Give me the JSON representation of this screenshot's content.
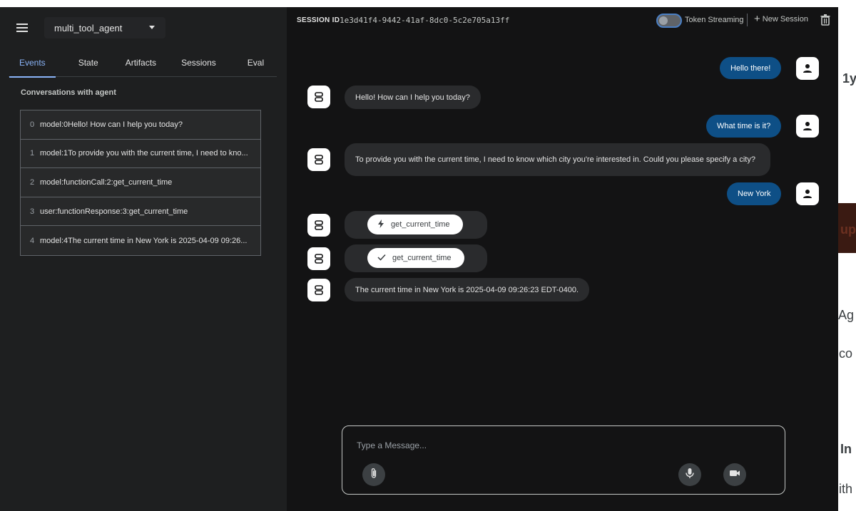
{
  "header": {
    "agent_name": "multi_tool_agent",
    "session_label": "SESSION ID",
    "session_id": "1e3d41f4-9442-41af-8dc0-5c2e705a13ff",
    "token_streaming_label": "Token Streaming",
    "token_streaming_enabled": false,
    "new_session_label": "New Session"
  },
  "tabs": [
    {
      "label": "Events",
      "active": true
    },
    {
      "label": "State",
      "active": false
    },
    {
      "label": "Artifacts",
      "active": false
    },
    {
      "label": "Sessions",
      "active": false
    },
    {
      "label": "Eval",
      "active": false
    }
  ],
  "sidebar": {
    "conversations_title": "Conversations with agent",
    "events": [
      {
        "index": "0",
        "text": "model:0Hello! How can I help you today?"
      },
      {
        "index": "1",
        "text": "model:1To provide you with the current time, I need to kno..."
      },
      {
        "index": "2",
        "text": "model:functionCall:2:get_current_time"
      },
      {
        "index": "3",
        "text": "user:functionResponse:3:get_current_time"
      },
      {
        "index": "4",
        "text": "model:4The current time in New York is 2025-04-09 09:26..."
      }
    ]
  },
  "chat": {
    "messages": [
      {
        "role": "user",
        "text": "Hello there!"
      },
      {
        "role": "bot",
        "text": "Hello! How can I help you today?"
      },
      {
        "role": "user",
        "text": "What time is it?"
      },
      {
        "role": "bot",
        "text": "To provide you with the current time, I need to know which city you're interested in. Could you please specify a city?"
      },
      {
        "role": "user",
        "text": "New York"
      },
      {
        "role": "bot",
        "type": "function_call",
        "icon": "bolt-icon",
        "text": "get_current_time"
      },
      {
        "role": "bot",
        "type": "function_response",
        "icon": "check-icon",
        "text": "get_current_time"
      },
      {
        "role": "bot",
        "text": "The current time in New York is 2025-04-09 09:26:23 EDT-0400."
      }
    ]
  },
  "input": {
    "placeholder": "Type a Message..."
  },
  "background_fragments": [
    "1y",
    "up",
    "Ag",
    "co",
    "In",
    "ith"
  ],
  "colors": {
    "accent": "#8ab4f8",
    "user_bubble": "#0e4f86",
    "bot_bubble": "#2a2b2d",
    "sidebar_bg": "#1e1f20",
    "main_bg": "#131314"
  }
}
